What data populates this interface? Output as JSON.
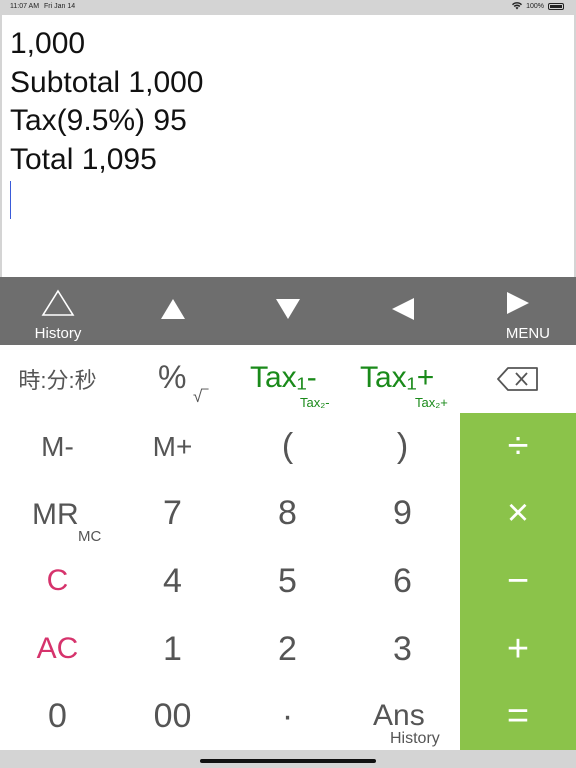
{
  "status_bar": {
    "time": "11:07 AM",
    "date": "Fri Jan 14",
    "battery": "100%"
  },
  "display": {
    "lines": [
      "1,000",
      "Subtotal 1,000",
      "Tax(9.5%) 95",
      "Total 1,095"
    ]
  },
  "toolbar": {
    "history_label": "History",
    "menu_label": "MENU"
  },
  "keys": {
    "time": "時:分:秒",
    "percent": "%",
    "root": "√‾",
    "tax1_minus": "Tax₁-",
    "tax2_minus": "Tax₂-",
    "tax1_plus": "Tax₁+",
    "tax2_plus": "Tax₂+",
    "m_minus": "M-",
    "m_plus": "M+",
    "paren_open": "(",
    "paren_close": ")",
    "mr": "MR",
    "mc": "MC",
    "seven": "7",
    "eight": "8",
    "nine": "9",
    "c": "C",
    "four": "4",
    "five": "5",
    "six": "6",
    "ac": "AC",
    "one": "1",
    "two": "2",
    "three": "3",
    "zero": "0",
    "double_zero": "00",
    "dot": "·",
    "ans": "Ans",
    "ans_history": "History",
    "divide": "÷",
    "multiply": "×",
    "minus": "−",
    "plus": "+",
    "equals": "="
  },
  "colors": {
    "ops_bg": "#8bc34a",
    "tax": "#1a8a1a",
    "clear": "#d6336c",
    "toolbar": "#6e6e6e"
  }
}
